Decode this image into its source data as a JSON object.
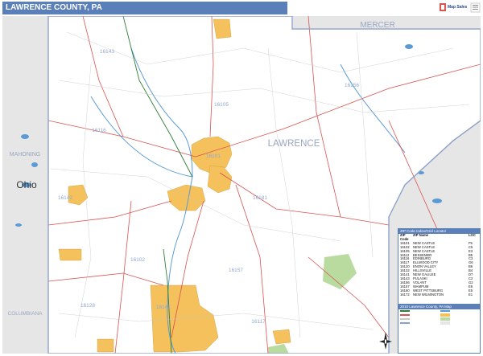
{
  "header": {
    "title": "LAWRENCE COUNTY, PA"
  },
  "logo": {
    "text": "Map Sales"
  },
  "map": {
    "labels": {
      "county": "LAWRENCE",
      "mercer": "MERCER",
      "mahoning": "MAHONING",
      "ohio": "Ohio",
      "columbiana": "COLUMBIANA"
    },
    "zip_labels": [
      "16143",
      "16105",
      "16116",
      "16101",
      "16142",
      "16156",
      "16181",
      "16102",
      "16157",
      "16128",
      "16141",
      "16117"
    ],
    "colors": {
      "land": "#ffffff",
      "outside": "#e6e6e6",
      "city": "#f5c15c",
      "road": "#d9534f",
      "water": "#5a9bd5",
      "border": "#8aa0c8"
    }
  },
  "zip_legend": {
    "title": "ZIP Code Index/Grid Locator",
    "columns": [
      "ZIP Code",
      "ZIP Name",
      "LOC"
    ],
    "rows": [
      [
        "16101",
        "NEW CASTLE",
        "F5"
      ],
      [
        "16102",
        "NEW CASTLE",
        "C5"
      ],
      [
        "16105",
        "NEW CASTLE",
        "E3"
      ],
      [
        "16112",
        "BESSEMER",
        "B5"
      ],
      [
        "16116",
        "EDINBURG",
        "C3"
      ],
      [
        "16117",
        "ELLWOOD CITY",
        "G6"
      ],
      [
        "16120",
        "ENON VALLEY",
        "B6"
      ],
      [
        "16132",
        "HILLSVILLE",
        "B4"
      ],
      [
        "16141",
        "NEW GALILEE",
        "D7"
      ],
      [
        "16143",
        "PULASKI",
        "C2"
      ],
      [
        "16156",
        "VOLANT",
        "G2"
      ],
      [
        "16157",
        "WAMPUM",
        "E6"
      ],
      [
        "16160",
        "WEST PITTSBURG",
        "E5"
      ],
      [
        "16172",
        "NEW WILMINGTON",
        "E1"
      ]
    ]
  },
  "map_legend": {
    "title": "2010 Lawrence County, PA Map"
  }
}
